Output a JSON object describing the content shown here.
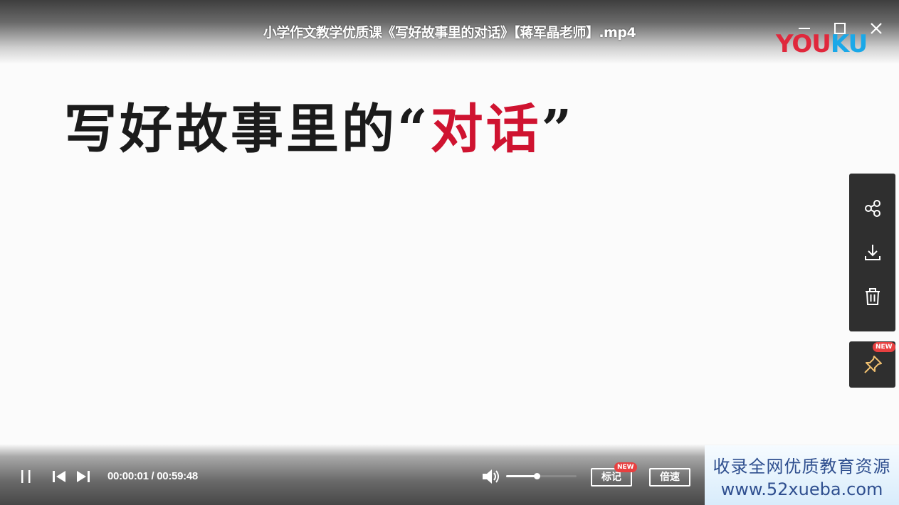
{
  "window": {
    "title": "小学作文教学优质课《写好故事里的对话》【蒋军晶老师】.mp4",
    "brand_you": "YOU",
    "brand_ku": "KU"
  },
  "slide": {
    "heading_main": "写好故事里的",
    "open_quote": "“",
    "heading_highlight": "对话",
    "close_quote": "”",
    "highlight_color": "#cf1330"
  },
  "side_panel": {
    "icons": [
      "share-icon",
      "download-icon",
      "trash-icon",
      "pin-icon"
    ],
    "pin_badge": "NEW"
  },
  "controls": {
    "time_current": "00:00:01",
    "time_separator": " / ",
    "time_total": "00:59:48",
    "volume_level": 0.43,
    "mark_label": "标记",
    "mark_badge": "NEW",
    "speed_label": "倍速"
  },
  "promo": {
    "line1": "收录全网优质教育资源",
    "line2": "www.52xueba.com"
  }
}
